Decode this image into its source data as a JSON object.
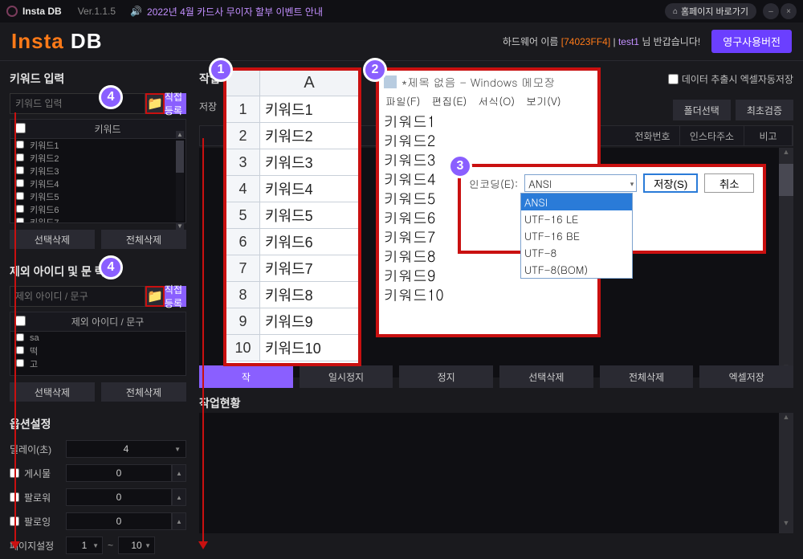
{
  "titlebar": {
    "product": "Insta DB",
    "version": "Ver.1.1.5",
    "notice": "2022년 4월 카드사 무이자 할부 이벤트 안내",
    "homepage": "홈페이지 바로가기"
  },
  "brand": {
    "insta": "Insta",
    "db": " DB",
    "hw_label": "하드웨어 이름 ",
    "hw_id": "[74023FF4]",
    "divider": " | ",
    "user": "test1",
    "greet": " 님 반갑습니다!",
    "license": "영구사용버전"
  },
  "left": {
    "section1_title": "키워드 입력",
    "input1_placeholder": "키워드 입력",
    "register": "직접등록",
    "list1_header": "키워드",
    "list1_items": [
      "키워드1",
      "키워드2",
      "키워드3",
      "키워드4",
      "키워드5",
      "키워드6",
      "키워드7"
    ],
    "sel_delete": "선택삭제",
    "all_delete": "전체삭제",
    "section2_title": "제외 아이디 및 문구 입력",
    "section2_title_short": "제외 아이디 및 문     력",
    "input2_placeholder": "제외 아이디 / 문구",
    "list2_header": "제외 아이디 / 문구",
    "list2_items": [
      "sa",
      "떡",
      "고"
    ],
    "opt_title": "옵션설정",
    "delay_label": "딜레이(초)",
    "delay_value": "4",
    "posts_label": "게시물",
    "posts_value": "0",
    "follower_label": "팔로워",
    "follower_value": "0",
    "following_label": "팔로잉",
    "following_value": "0",
    "page_label": "페이지설정",
    "page_from": "1",
    "page_to": "10"
  },
  "right": {
    "work_title": "작업",
    "save_label": "저장",
    "autosave_label": "데이터 추출시 엑셀자동저장",
    "folder_select": "폴더선택",
    "first_verify": "최초검증",
    "tbl_phone": "전화번호",
    "tbl_addr": "인스타주소",
    "tbl_memo": "비고",
    "btn_start": "작",
    "btn_pause": "일시정지",
    "btn_stop": "정지",
    "btn_sel_delete": "선택삭제",
    "btn_all_delete": "전체삭제",
    "btn_excel_save": "엑셀저장",
    "status_title": "작업현황"
  },
  "excel": {
    "colA": "A",
    "rows": [
      {
        "n": "1",
        "v": "키워드1"
      },
      {
        "n": "2",
        "v": "키워드2"
      },
      {
        "n": "3",
        "v": "키워드3"
      },
      {
        "n": "4",
        "v": "키워드4"
      },
      {
        "n": "5",
        "v": "키워드5"
      },
      {
        "n": "6",
        "v": "키워드6"
      },
      {
        "n": "7",
        "v": "키워드7"
      },
      {
        "n": "8",
        "v": "키워드8"
      },
      {
        "n": "9",
        "v": "키워드9"
      },
      {
        "n": "10",
        "v": "키워드10"
      }
    ]
  },
  "notepad": {
    "title": "*제목 없음 - Windows 메모장",
    "menu_file": "파일(F)",
    "menu_edit": "편집(E)",
    "menu_format": "서식(O)",
    "menu_view": "보기(V)",
    "lines": [
      "키워드1",
      "키워드2",
      "키워드3",
      "키워드4",
      "키워드5",
      "키워드6",
      "키워드7",
      "키워드8",
      "키워드9",
      "키워드10"
    ]
  },
  "encoding": {
    "label": "인코딩(E):",
    "selected": "ANSI",
    "save": "저장(S)",
    "cancel": "취소",
    "options": [
      "ANSI",
      "UTF-16 LE",
      "UTF-16 BE",
      "UTF-8",
      "UTF-8(BOM)"
    ]
  },
  "badges": {
    "b1": "1",
    "b2": "2",
    "b3": "3",
    "b4": "4"
  }
}
